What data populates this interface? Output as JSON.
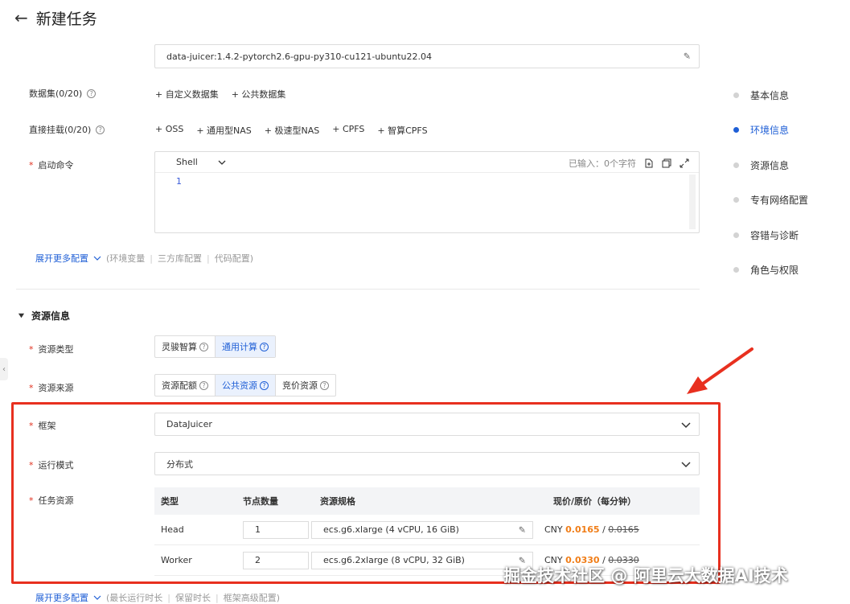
{
  "header": {
    "title": "新建任务",
    "back_icon": "arrow-left-icon"
  },
  "image": {
    "value": "data-juicer:1.4.2-pytorch2.6-gpu-py310-cu121-ubuntu22.04"
  },
  "dataset": {
    "label": "数据集(0/20)",
    "actions": [
      "+ 自定义数据集",
      "+ 公共数据集"
    ]
  },
  "mount": {
    "label": "直接挂载(0/20)",
    "actions": [
      "+ OSS",
      "+ 通用型NAS",
      "+ 极速型NAS",
      "+ CPFS",
      "+ 智算CPFS"
    ]
  },
  "command": {
    "label": "启动命令",
    "lang": "Shell",
    "counter": "已输入：0个字符",
    "line_number": "1"
  },
  "more_config_1": {
    "link": "展开更多配置",
    "items": [
      "(环境变量",
      "|",
      "三方库配置",
      "|",
      "代码配置)"
    ]
  },
  "resource_section": {
    "title": "资源信息"
  },
  "resource_type": {
    "label": "资源类型",
    "options": [
      "灵骏智算",
      "通用计算"
    ],
    "active_index": 1
  },
  "resource_source": {
    "label": "资源来源",
    "options": [
      "资源配额",
      "公共资源",
      "竞价资源"
    ],
    "active_index": 1
  },
  "framework": {
    "label": "框架",
    "value": "DataJuicer"
  },
  "run_mode": {
    "label": "运行模式",
    "value": "分布式"
  },
  "task_resource": {
    "label": "任务资源",
    "headers": [
      "类型",
      "节点数量",
      "资源规格",
      "现价/原价（每分钟）"
    ],
    "rows": [
      {
        "type": "Head",
        "count": "1",
        "spec": "ecs.g6.xlarge  (4 vCPU, 16 GiB)",
        "currency": "CNY",
        "price_now": "0.0165",
        "slash": " / ",
        "price_old": "0.0165"
      },
      {
        "type": "Worker",
        "count": "2",
        "spec": "ecs.g6.2xlarge  (8 vCPU, 32 GiB)",
        "currency": "CNY",
        "price_now": "0.0330",
        "slash": " / ",
        "price_old": "0.0330"
      }
    ]
  },
  "more_config_2": {
    "link": "展开更多配置",
    "items": [
      "(最长运行时长",
      "|",
      "保留时长",
      "|",
      "框架高级配置)"
    ]
  },
  "side_nav": {
    "items": [
      "基本信息",
      "环境信息",
      "资源信息",
      "专有网络配置",
      "容错与诊断",
      "角色与权限"
    ],
    "active_index": 1
  },
  "watermark": "掘金技术社区 @ 阿里云大数据AI技术",
  "colors": {
    "accent": "#1f5fd6",
    "highlight_box": "#e8301f",
    "price": "#f07d17"
  }
}
